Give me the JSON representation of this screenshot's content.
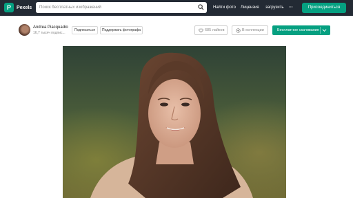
{
  "header": {
    "logo_letter": "P",
    "brand": "Pexels",
    "search_placeholder": "Поиск бесплатных изображений",
    "nav_links": [
      "Найти фото",
      "Лицензия",
      "загрузить"
    ],
    "more": "···",
    "join_label": "Присоединиться"
  },
  "author": {
    "name": "Andrea Piacquadio",
    "followers": "16,7 тысяч подпис...",
    "subscribe_label": "Подписаться",
    "support_label": "Поддержать фотографа"
  },
  "actions": {
    "like_label": "685 лайков",
    "collection_label": "В коллекции",
    "download_label": "Бесплатное скачивание"
  },
  "colors": {
    "accent": "#05a081",
    "nav_bg": "#232a34"
  },
  "icons": [
    "search-icon",
    "heart-icon",
    "plus-circle-icon",
    "chevron-down-icon"
  ]
}
